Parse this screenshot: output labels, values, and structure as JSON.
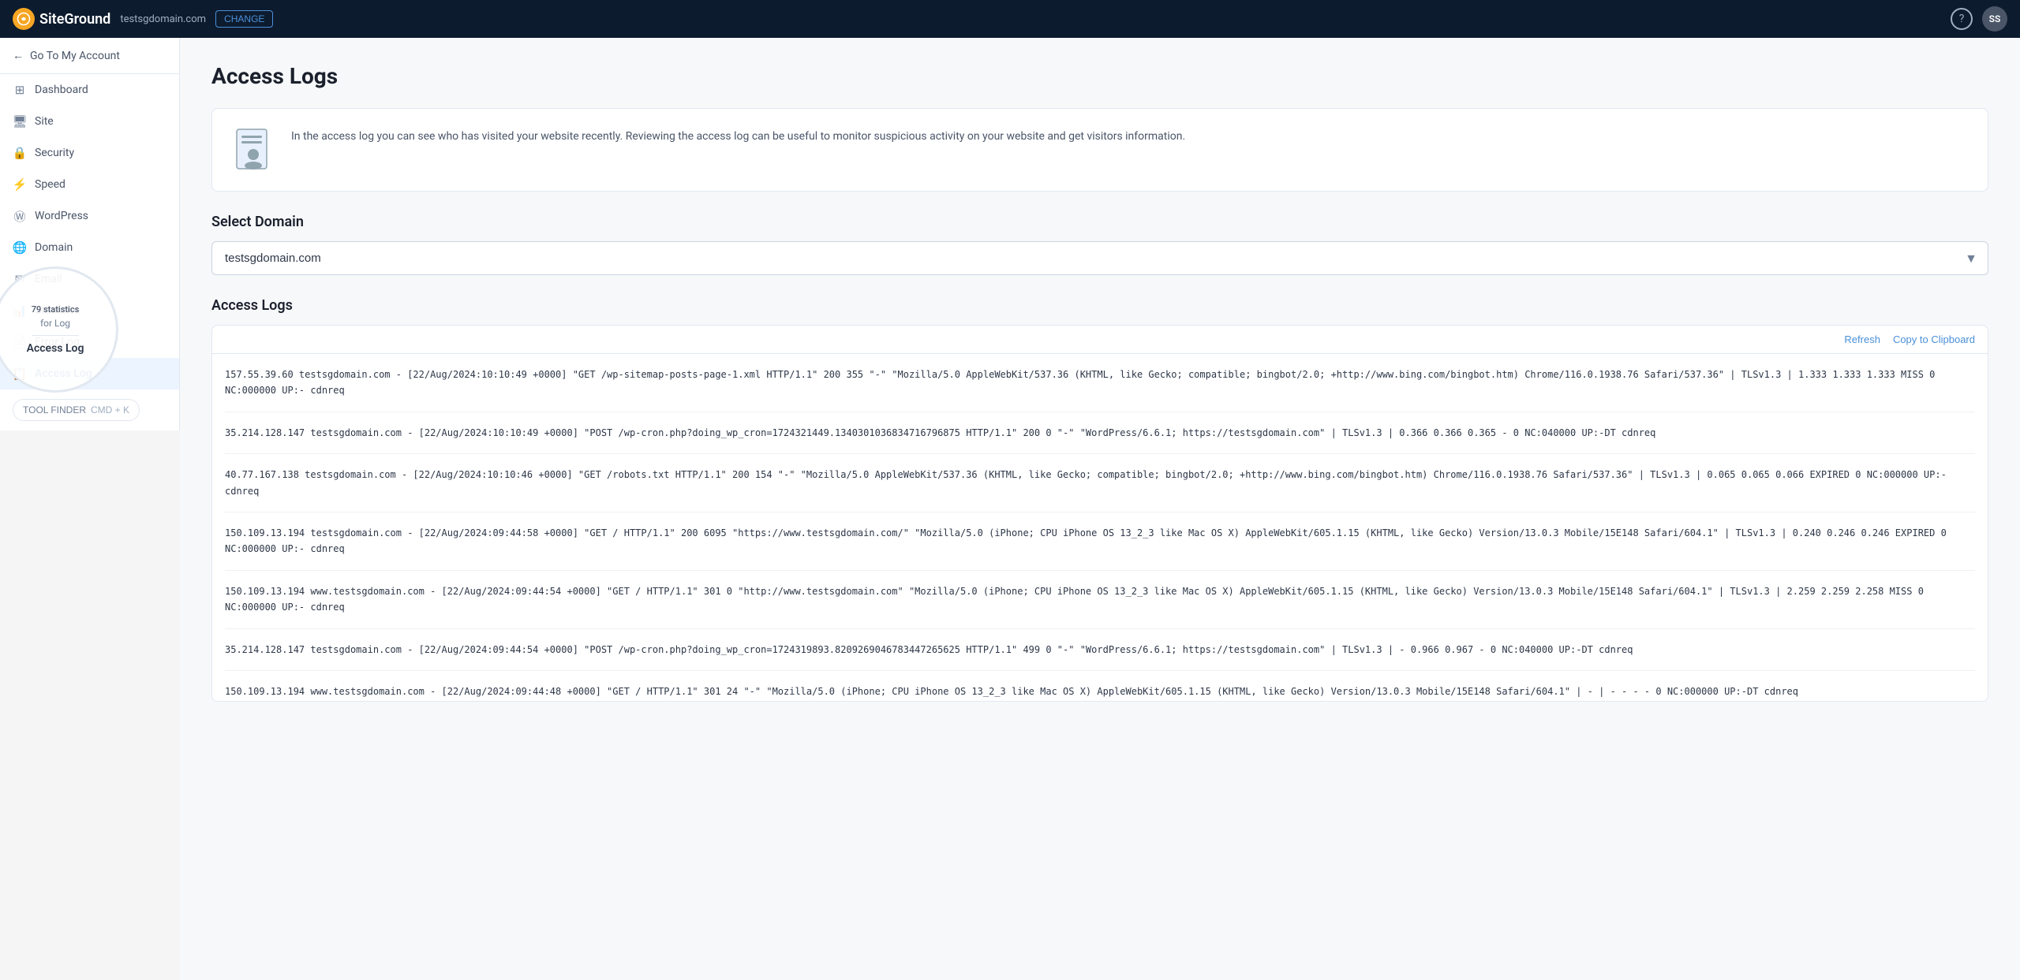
{
  "topnav": {
    "domain": "testsgdomain.com",
    "change_label": "CHANGE",
    "help_icon": "?",
    "avatar_initials": "SS"
  },
  "sidebar": {
    "back_label": "Go To My Account",
    "items": [
      {
        "id": "dashboard",
        "label": "Dashboard",
        "icon": "grid"
      },
      {
        "id": "site",
        "label": "Site",
        "icon": "monitor"
      },
      {
        "id": "security",
        "label": "Security",
        "icon": "lock"
      },
      {
        "id": "speed",
        "label": "Speed",
        "icon": "zap"
      },
      {
        "id": "wordpress",
        "label": "WordPress",
        "icon": "wp"
      },
      {
        "id": "domain",
        "label": "Domain",
        "icon": "globe"
      },
      {
        "id": "email",
        "label": "Email",
        "icon": "email"
      },
      {
        "id": "statistics",
        "label": "Statistics",
        "icon": "chart"
      },
      {
        "id": "error-log",
        "label": "Error Log",
        "icon": "file"
      },
      {
        "id": "access-log",
        "label": "Access Log",
        "icon": "file-text",
        "active": true
      }
    ],
    "tool_finder_label": "TOOL FINDER",
    "tool_finder_shortcut": "CMD + K",
    "magnifier": {
      "stat_label": "79 statistics",
      "access_label": "Access Log"
    }
  },
  "main": {
    "page_title": "Access Logs",
    "info_text": "In the access log you can see who has visited your website recently. Reviewing the access log can be useful to monitor suspicious activity on your website and get visitors information.",
    "select_domain_label": "Select Domain",
    "selected_domain": "testsgdomain.com",
    "access_logs_label": "Access Logs",
    "toolbar": {
      "refresh_label": "Refresh",
      "copy_label": "Copy to Clipboard"
    },
    "log_entries": [
      "157.55.39.60 testsgdomain.com - [22/Aug/2024:10:10:49 +0000] \"GET /wp-sitemap-posts-page-1.xml HTTP/1.1\" 200 355 \"-\" \"Mozilla/5.0 AppleWebKit/537.36 (KHTML, like Gecko; compatible; bingbot/2.0; +http://www.bing.com/bingbot.htm) Chrome/116.0.1938.76 Safari/537.36\" | TLSv1.3 | 1.333 1.333 1.333 MISS 0 NC:000000 UP:- cdnreq",
      "35.214.128.147 testsgdomain.com - [22/Aug/2024:10:10:49 +0000] \"POST /wp-cron.php?doing_wp_cron=1724321449.1340301036834716796875 HTTP/1.1\" 200 0 \"-\" \"WordPress/6.6.1; https://testsgdomain.com\" | TLSv1.3 | 0.366 0.366 0.365 - 0 NC:040000 UP:-DT cdnreq",
      "40.77.167.138 testsgdomain.com - [22/Aug/2024:10:10:46 +0000] \"GET /robots.txt HTTP/1.1\" 200 154 \"-\" \"Mozilla/5.0 AppleWebKit/537.36 (KHTML, like Gecko; compatible; bingbot/2.0; +http://www.bing.com/bingbot.htm) Chrome/116.0.1938.76 Safari/537.36\" | TLSv1.3 | 0.065 0.065 0.066 EXPIRED 0 NC:000000 UP:- cdnreq",
      "150.109.13.194 testsgdomain.com - [22/Aug/2024:09:44:58 +0000] \"GET / HTTP/1.1\" 200 6095 \"https://www.testsgdomain.com/\" \"Mozilla/5.0 (iPhone; CPU iPhone OS 13_2_3 like Mac OS X) AppleWebKit/605.1.15 (KHTML, like Gecko) Version/13.0.3 Mobile/15E148 Safari/604.1\" | TLSv1.3 | 0.240 0.246 0.246 EXPIRED 0 NC:000000 UP:- cdnreq",
      "150.109.13.194 www.testsgdomain.com - [22/Aug/2024:09:44:54 +0000] \"GET / HTTP/1.1\" 301 0 \"http://www.testsgdomain.com\" \"Mozilla/5.0 (iPhone; CPU iPhone OS 13_2_3 like Mac OS X) AppleWebKit/605.1.15 (KHTML, like Gecko) Version/13.0.3 Mobile/15E148 Safari/604.1\" | TLSv1.3 | 2.259 2.259 2.258 MISS 0 NC:000000 UP:- cdnreq",
      "35.214.128.147 testsgdomain.com - [22/Aug/2024:09:44:54 +0000] \"POST /wp-cron.php?doing_wp_cron=1724319893.8209269046783447265625 HTTP/1.1\" 499 0 \"-\" \"WordPress/6.6.1; https://testsgdomain.com\" | TLSv1.3 | - 0.966 0.967 - 0 NC:040000 UP:-DT cdnreq",
      "150.109.13.194 www.testsgdomain.com - [22/Aug/2024:09:44:48 +0000] \"GET / HTTP/1.1\" 301 24 \"-\" \"Mozilla/5.0 (iPhone; CPU iPhone OS 13_2_3 like Mac OS X) AppleWebKit/605.1.15 (KHTML, like Gecko) Version/13.0.3 Mobile/15E148 Safari/604.1\" | - | - - - - 0 NC:000000 UP:-DT cdnreq"
    ]
  }
}
